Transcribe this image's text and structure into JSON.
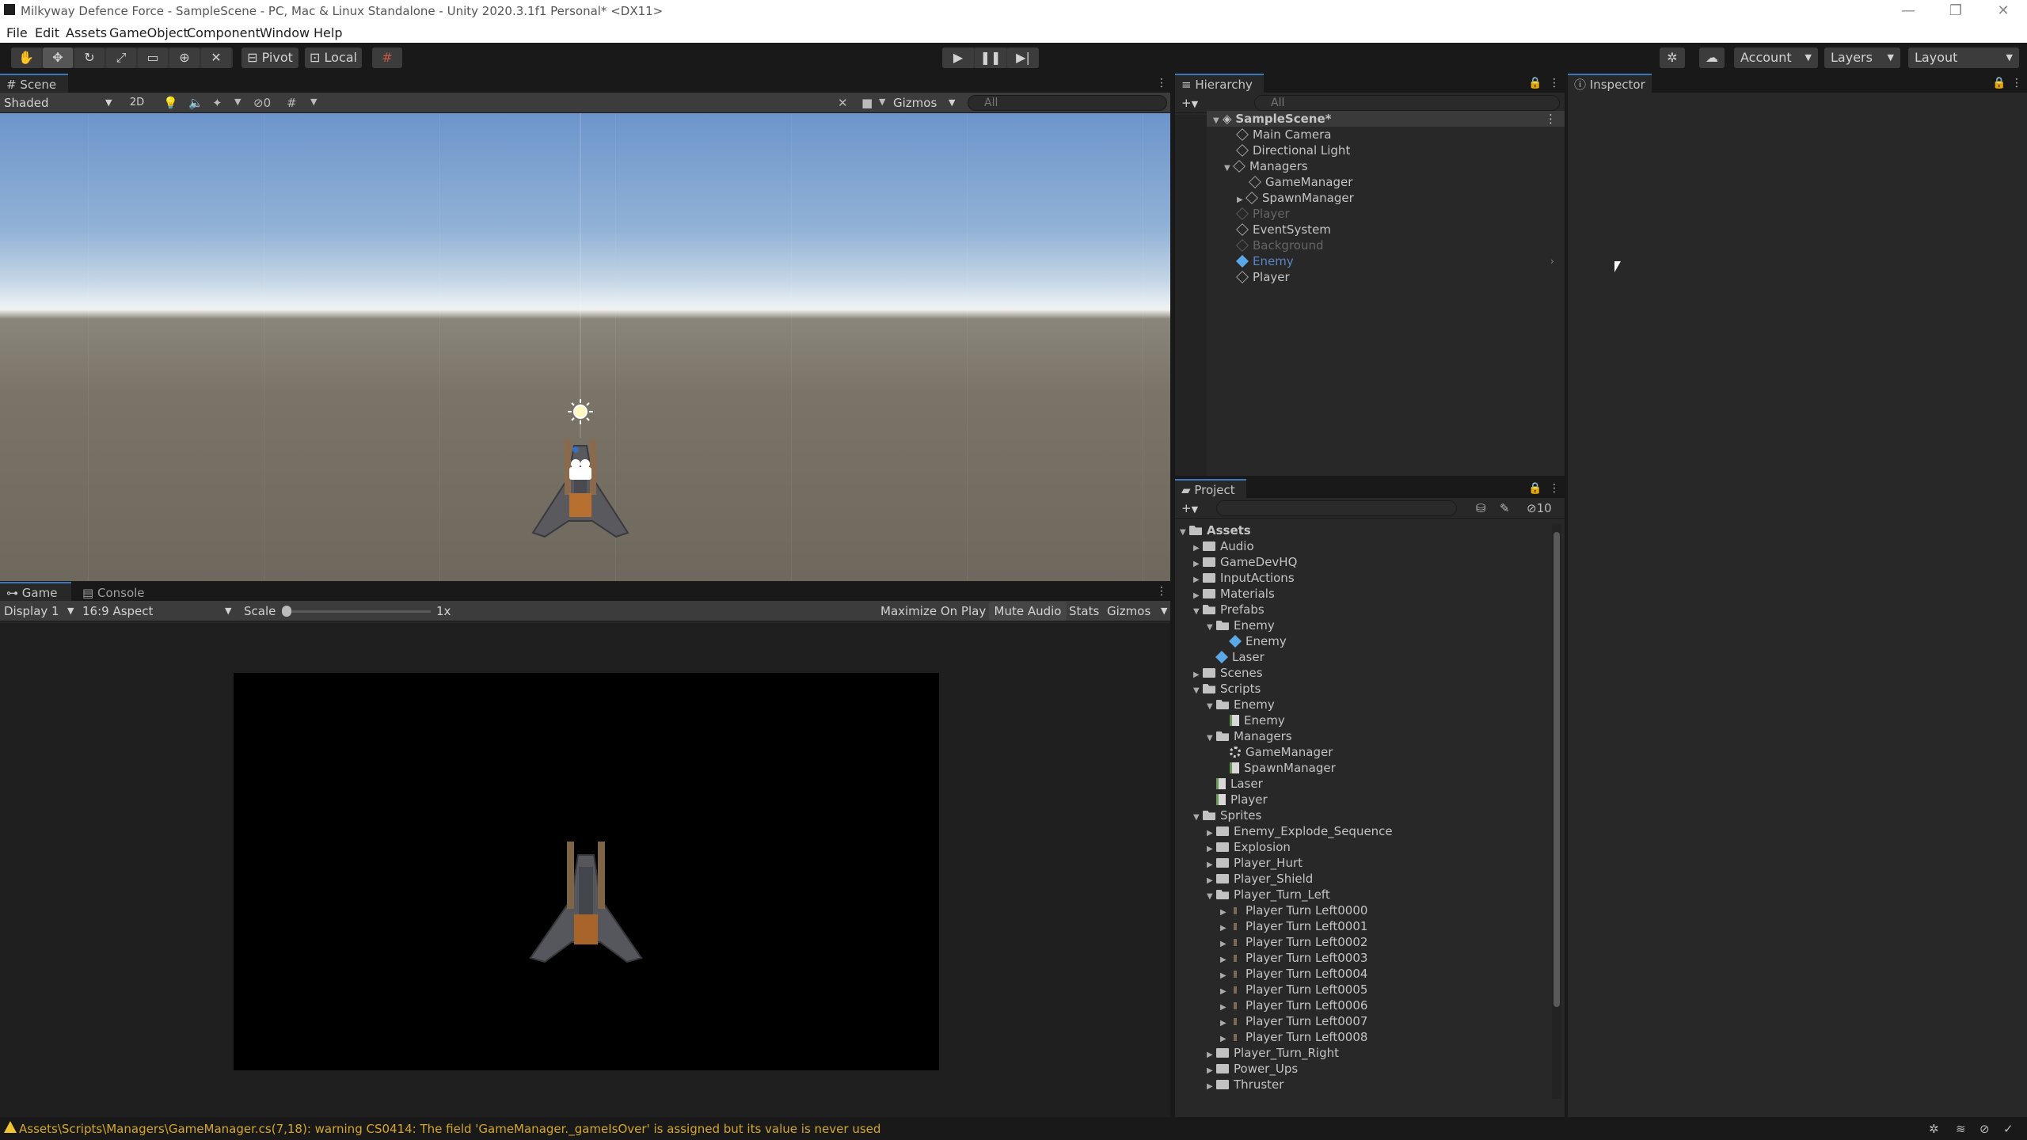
{
  "window": {
    "title": "Milkyway Defence Force - SampleScene - PC, Mac & Linux Standalone - Unity 2020.3.1f1 Personal* <DX11>",
    "minimize": "—",
    "maximize": "❐",
    "close": "✕"
  },
  "menu": [
    "File",
    "Edit",
    "Assets",
    "GameObject",
    "Component",
    "Window",
    "Help"
  ],
  "toolbar": {
    "pivot_label": "Pivot",
    "local_label": "Local",
    "account_label": "Account",
    "layers_label": "Layers",
    "layout_label": "Layout"
  },
  "scene": {
    "tab": "Scene",
    "draw_mode": "Shaded",
    "toggle_2d": "2D",
    "hidden_count": "0",
    "gizmos": "Gizmos",
    "search_placeholder": "All"
  },
  "game": {
    "tabs": [
      "Game",
      "Console"
    ],
    "display": "Display 1",
    "aspect": "16:9 Aspect",
    "scale_label": "Scale",
    "scale_value": "1x",
    "maximize_on_play": "Maximize On Play",
    "mute_audio": "Mute Audio",
    "stats": "Stats",
    "gizmos": "Gizmos"
  },
  "hierarchy": {
    "tab": "Hierarchy",
    "search_placeholder": "All",
    "scene_name": "SampleScene*",
    "items": [
      {
        "label": "Main Camera"
      },
      {
        "label": "Directional Light"
      },
      {
        "label": "Managers"
      },
      {
        "label": "GameManager"
      },
      {
        "label": "SpawnManager"
      },
      {
        "label": "Player"
      },
      {
        "label": "EventSystem"
      },
      {
        "label": "Background"
      },
      {
        "label": "Enemy"
      },
      {
        "label": "Player"
      }
    ]
  },
  "inspector": {
    "tab": "Inspector"
  },
  "project": {
    "tab": "Project",
    "hidden_count": "10",
    "items": [
      {
        "label": "Assets"
      },
      {
        "label": "Audio"
      },
      {
        "label": "GameDevHQ"
      },
      {
        "label": "InputActions"
      },
      {
        "label": "Materials"
      },
      {
        "label": "Prefabs"
      },
      {
        "label": "Enemy"
      },
      {
        "label": "Enemy"
      },
      {
        "label": "Laser"
      },
      {
        "label": "Scenes"
      },
      {
        "label": "Scripts"
      },
      {
        "label": "Enemy"
      },
      {
        "label": "Enemy"
      },
      {
        "label": "Managers"
      },
      {
        "label": "GameManager"
      },
      {
        "label": "SpawnManager"
      },
      {
        "label": "Laser"
      },
      {
        "label": "Player"
      },
      {
        "label": "Sprites"
      },
      {
        "label": "Enemy_Explode_Sequence"
      },
      {
        "label": "Explosion"
      },
      {
        "label": "Player_Hurt"
      },
      {
        "label": "Player_Shield"
      },
      {
        "label": "Player_Turn_Left"
      },
      {
        "label": "Player Turn Left0000"
      },
      {
        "label": "Player Turn Left0001"
      },
      {
        "label": "Player Turn Left0002"
      },
      {
        "label": "Player Turn Left0003"
      },
      {
        "label": "Player Turn Left0004"
      },
      {
        "label": "Player Turn Left0005"
      },
      {
        "label": "Player Turn Left0006"
      },
      {
        "label": "Player Turn Left0007"
      },
      {
        "label": "Player Turn Left0008"
      },
      {
        "label": "Player_Turn_Right"
      },
      {
        "label": "Power_Ups"
      },
      {
        "label": "Thruster"
      }
    ]
  },
  "status": {
    "message": "Assets\\Scripts\\Managers\\GameManager.cs(7,18): warning CS0414: The field 'GameManager._gameIsOver' is assigned but its value is never used"
  }
}
